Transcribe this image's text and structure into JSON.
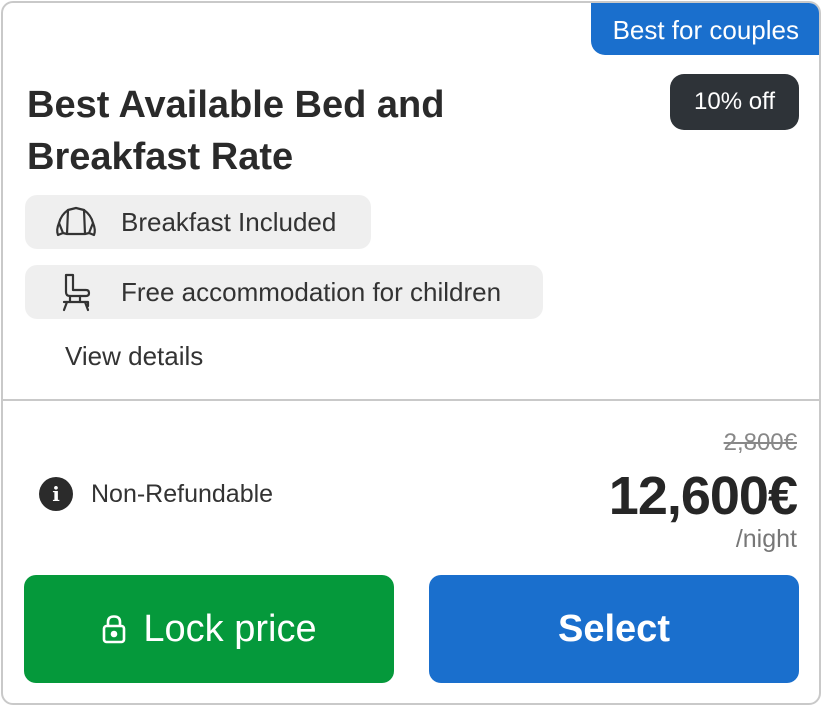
{
  "ribbon": {
    "label": "Best for couples"
  },
  "discount": {
    "label": "10% off"
  },
  "rate": {
    "title": "Best Available Bed and Breakfast Rate"
  },
  "amenities": [
    {
      "icon": "croissant-icon",
      "label": "Breakfast Included"
    },
    {
      "icon": "high-chair-icon",
      "label": "Free accommodation for children"
    }
  ],
  "details_link": "View details",
  "refund": {
    "icon": "info-icon",
    "label": "Non-Refundable"
  },
  "pricing": {
    "old_price": "2,800€",
    "price": "12,600€",
    "per": "/night"
  },
  "buttons": {
    "lock_label": "Lock price",
    "select_label": "Select"
  },
  "colors": {
    "accent_blue": "#1a6fcd",
    "lock_green": "#05993b",
    "badge_dark": "#2e3338"
  }
}
